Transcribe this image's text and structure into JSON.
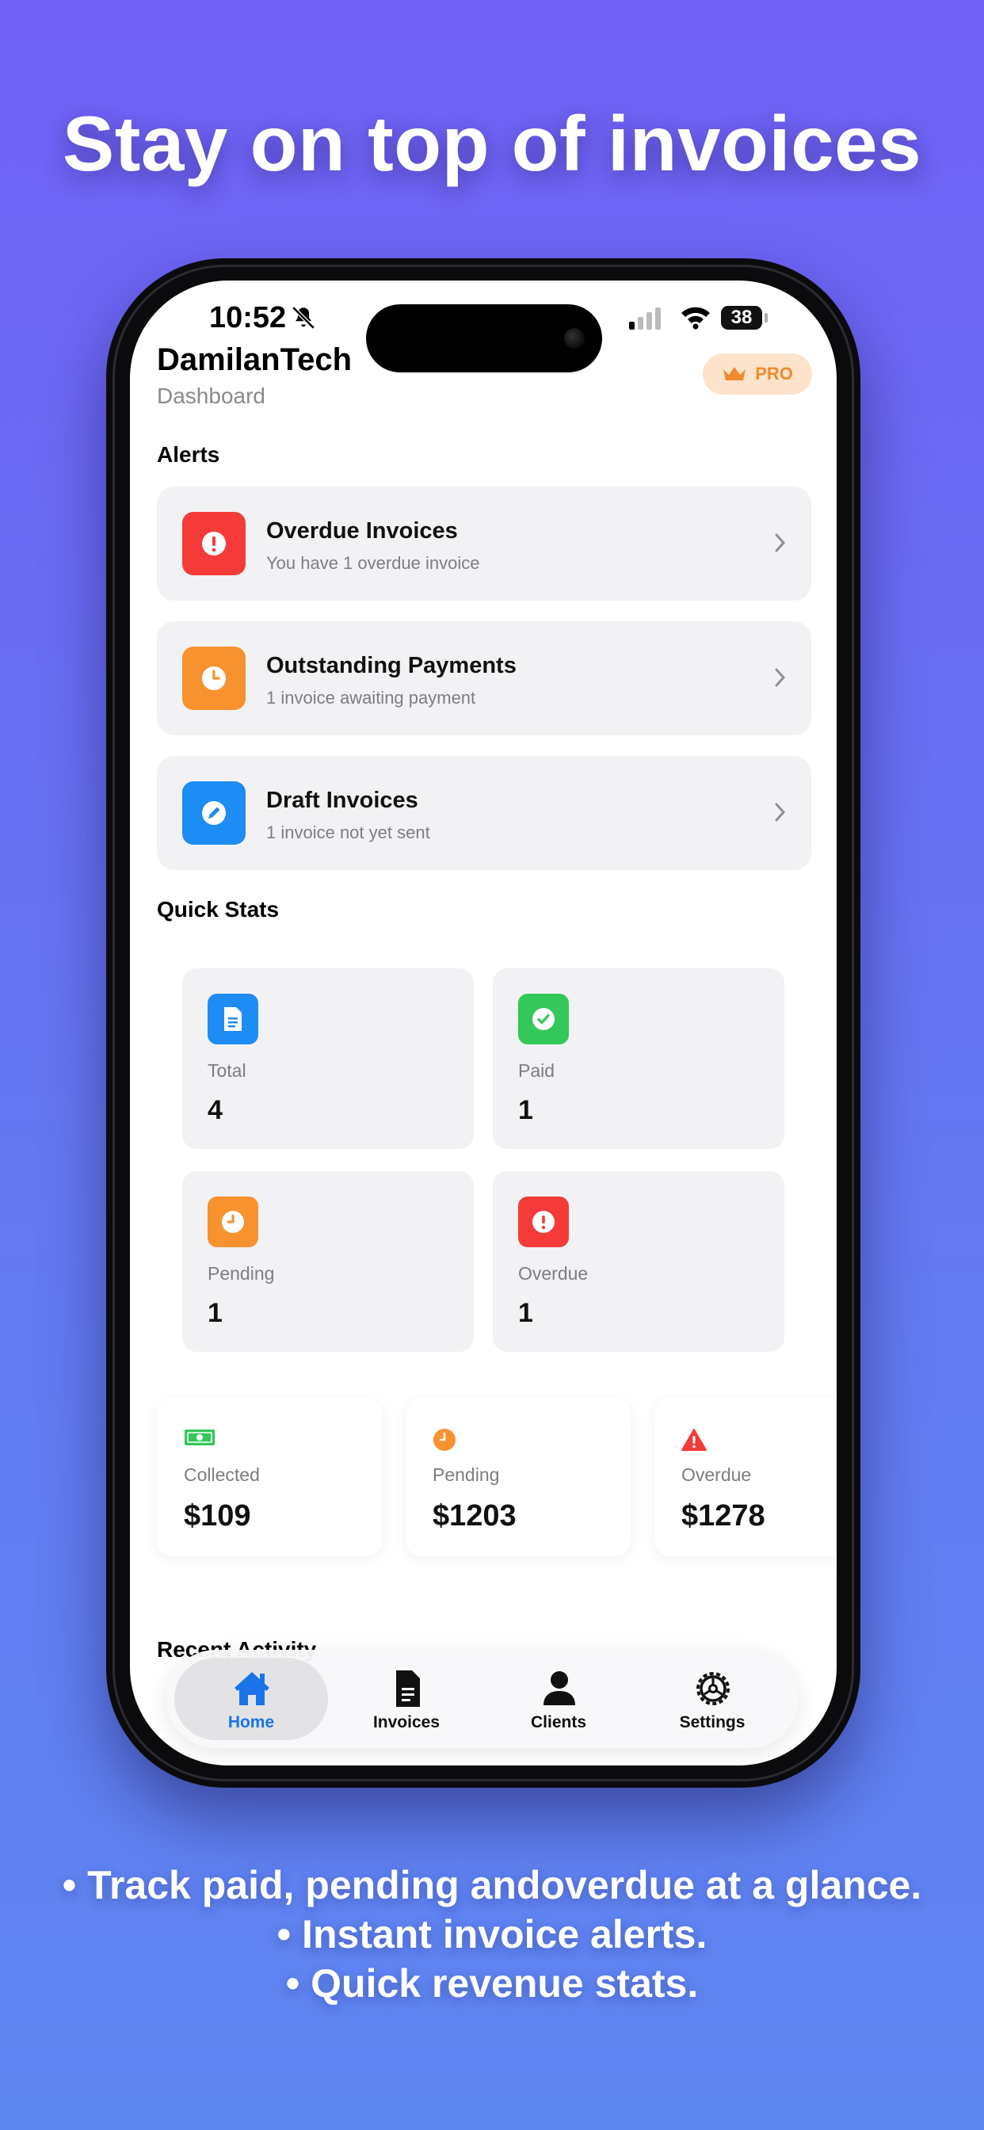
{
  "headline": "Stay on top of invoices",
  "status_bar": {
    "time": "10:52",
    "battery": "38"
  },
  "app": {
    "title": "DamilanTech",
    "subtitle": "Dashboard",
    "badge": "PRO"
  },
  "alerts": {
    "section_title": "Alerts",
    "items": [
      {
        "title": "Overdue Invoices",
        "subtitle": "You have 1 overdue invoice",
        "icon": "exclamation-circle-icon",
        "color": "#f53a3a"
      },
      {
        "title": "Outstanding Payments",
        "subtitle": "1 invoice awaiting payment",
        "icon": "clock-icon",
        "color": "#f7922f"
      },
      {
        "title": "Draft Invoices",
        "subtitle": "1 invoice not yet sent",
        "icon": "pencil-circle-icon",
        "color": "#1d8cf4"
      }
    ]
  },
  "quick_stats": {
    "section_title": "Quick Stats",
    "items": [
      {
        "label": "Total",
        "value": "4",
        "icon": "document-icon",
        "color": "#1d8cf4"
      },
      {
        "label": "Paid",
        "value": "1",
        "icon": "checkmark-circle-icon",
        "color": "#34c759"
      },
      {
        "label": "Pending",
        "value": "1",
        "icon": "clock-icon",
        "color": "#f7922f"
      },
      {
        "label": "Overdue",
        "value": "1",
        "icon": "exclamation-circle-icon",
        "color": "#f53a3a"
      }
    ]
  },
  "revenue": [
    {
      "label": "Collected",
      "value": "$109",
      "icon": "banknote-icon",
      "color": "#34c759"
    },
    {
      "label": "Pending",
      "value": "$1203",
      "icon": "clock-icon",
      "color": "#f7922f"
    },
    {
      "label": "Overdue",
      "value": "$1278",
      "icon": "warning-triangle-icon",
      "color": "#f53a3a"
    }
  ],
  "recent_activity": {
    "section_title": "Recent Activity"
  },
  "tabbar": {
    "tabs": [
      {
        "label": "Home",
        "icon": "house-icon",
        "active": true
      },
      {
        "label": "Invoices",
        "icon": "document-icon",
        "active": false
      },
      {
        "label": "Clients",
        "icon": "person-icon",
        "active": false
      },
      {
        "label": "Settings",
        "icon": "gear-icon",
        "active": false
      }
    ],
    "accent": "#1a73e8"
  },
  "bullets": [
    "• Track paid, pending andoverdue at a glance.",
    "• Instant invoice alerts.",
    "• Quick revenue stats."
  ]
}
